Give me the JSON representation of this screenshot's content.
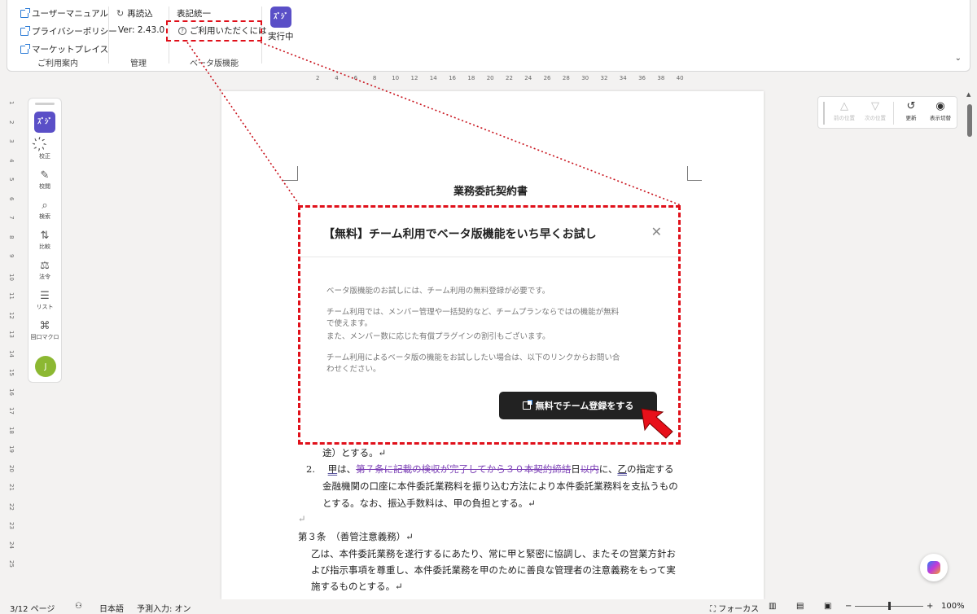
{
  "ribbon": {
    "guide": {
      "items": [
        "ユーザーマニュアル",
        "プライバシーポリシー",
        "マーケットプレイス"
      ],
      "label": "ご利用案内"
    },
    "manage": {
      "reload": "再読込",
      "version": "Ver: 2.43.0",
      "label": "管理"
    },
    "beta": {
      "item1": "表記統一",
      "item2": "ご利用いただくには",
      "label": "ベータ版機能"
    },
    "app": {
      "badge": "ｽﾞｼﾞ",
      "status": "実行中"
    }
  },
  "ruler_ticks": [
    "2",
    "4",
    "6",
    "8",
    "10",
    "12",
    "14",
    "16",
    "18",
    "20",
    "22",
    "24",
    "26",
    "28",
    "30",
    "32",
    "34",
    "36",
    "38",
    "40"
  ],
  "vruler_ticks": [
    "1",
    "2",
    "3",
    "4",
    "5",
    "6",
    "7",
    "8",
    "9",
    "10",
    "11",
    "12",
    "13",
    "14",
    "15",
    "16",
    "17",
    "18",
    "19",
    "20",
    "21",
    "22",
    "23",
    "24",
    "25"
  ],
  "sidebar": {
    "items": [
      {
        "label": "校正",
        "icon": "sparkle-icon"
      },
      {
        "label": "校閲",
        "icon": "review-icon"
      },
      {
        "label": "検索",
        "icon": "search-icon"
      },
      {
        "label": "比較",
        "icon": "compare-icon"
      },
      {
        "label": "法令",
        "icon": "law-icon"
      },
      {
        "label": "リスト",
        "icon": "list-icon"
      },
      {
        "label": "回口マクロ",
        "icon": "macro-icon"
      }
    ],
    "avatar": "J"
  },
  "review_panel": {
    "prev": "前の位置",
    "next": "次の位置",
    "refresh": "更新",
    "toggle": "表示切替"
  },
  "document": {
    "title": "業務委託契約書",
    "line1": "途）とする。↵",
    "line2_num": "2.",
    "line2_a": "甲",
    "line2_b": "は、",
    "line2_c": "第７条に記載の検収が完了してから３０本契約締結",
    "line2_d": "日",
    "line2_e": "以内",
    "line2_f": "に、",
    "line2_g": "乙",
    "line2_h": "の指定する",
    "line3": "金融機関の口座に本件委託業務料を振り込む方法により本件委託業務料を支払うもの",
    "line4": "とする。なお、振込手数料は、甲の負担とする。↵",
    "empty": "↵",
    "article3": "第３条　（善管注意義務）↵",
    "line5": "乙は、本件委託業務を遂行するにあたり、常に甲と緊密に協調し、またその営業方針お",
    "line6": "よび指示事項を尊重し、本件委託業務を甲のために善良な管理者の注意義務をもって実",
    "line7": "施するものとする。↵"
  },
  "modal": {
    "title": "【無料】チーム利用でベータ版機能をいち早くお試し",
    "p1": "ベータ版機能のお試しには、チーム利用の無料登録が必要です。",
    "p2a": "チーム利用では、メンバー管理や一括契約など、チームプランならではの機能が無料",
    "p2b": "で使えます。",
    "p2c": "また、メンバー数に応じた有償プラグインの割引もございます。",
    "p3a": "チーム利用によるベータ版の機能をお試ししたい場合は、以下のリンクからお問い合",
    "p3b": "わせください。",
    "button": "無料でチーム登録をする"
  },
  "status_bar": {
    "page": "3/12 ページ",
    "lang": "日本語",
    "predict": "予測入力: オン",
    "focus": "フォーカス",
    "zoom_minus": "−",
    "zoom_plus": "+",
    "zoom": "100%"
  },
  "colors": {
    "accent": "#5a4fc7",
    "highlight": "#e0101a",
    "button": "#222222"
  }
}
